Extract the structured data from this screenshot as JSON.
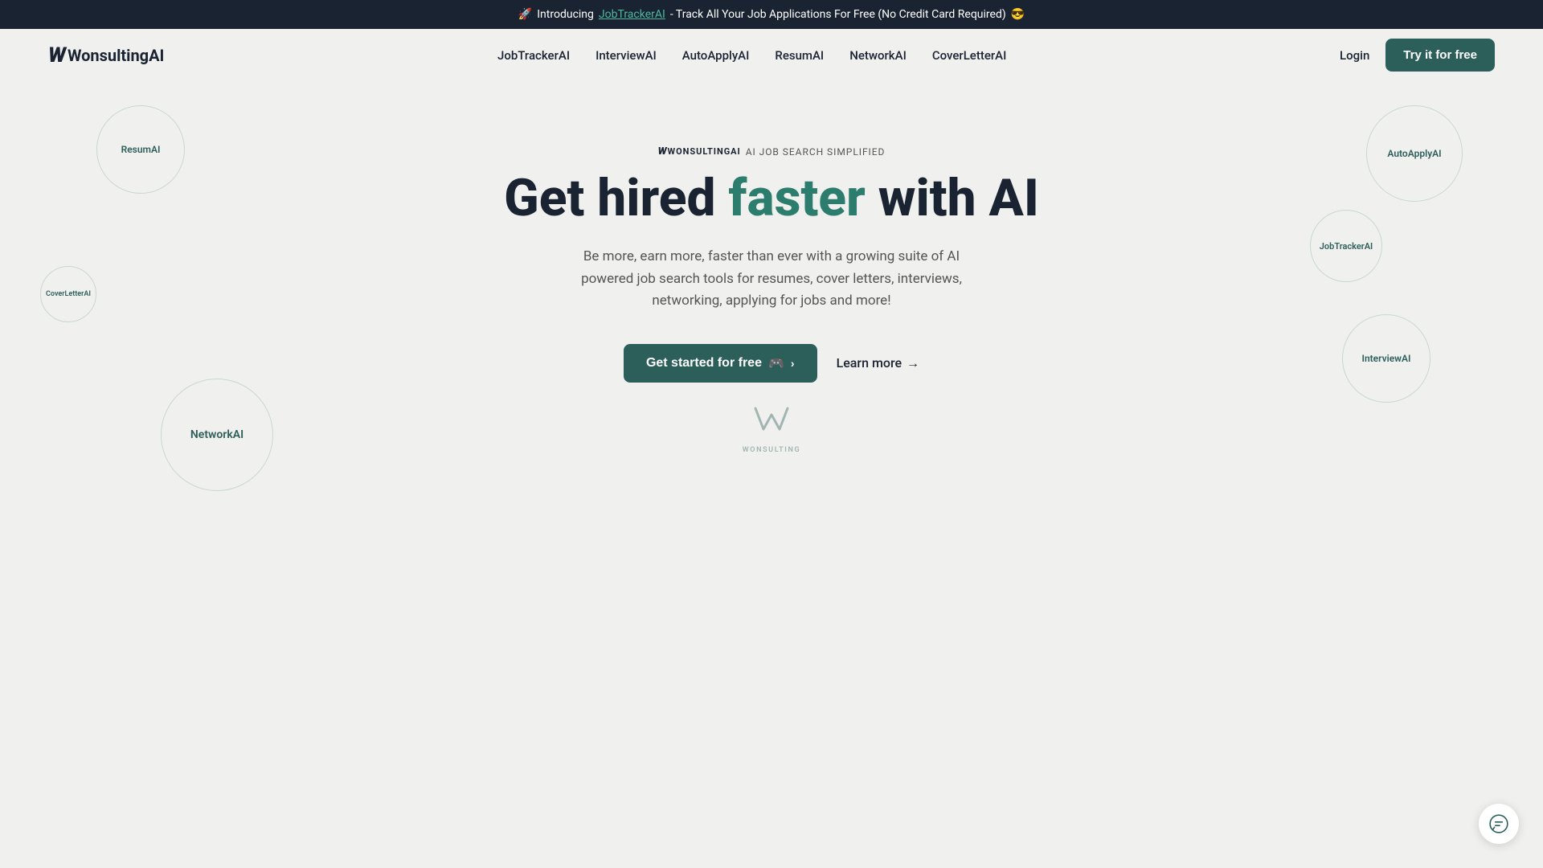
{
  "announcement": {
    "emoji_rocket": "🚀",
    "text_intro": "Introducing",
    "link_text": "JobTrackerAI",
    "text_after": "- Track All Your Job Applications For Free (No Credit Card Required)",
    "emoji_cool": "😎"
  },
  "nav": {
    "logo_text": "WonsultingAI",
    "logo_w": "W",
    "links": [
      {
        "label": "JobTrackerAI",
        "id": "nav-jobtracker"
      },
      {
        "label": "InterviewAI",
        "id": "nav-interviewai"
      },
      {
        "label": "AutoApplyAI",
        "id": "nav-autoapplyai"
      },
      {
        "label": "ResumAI",
        "id": "nav-resumai"
      },
      {
        "label": "NetworkAI",
        "id": "nav-networkai"
      },
      {
        "label": "CoverLetterAI",
        "id": "nav-coverletterai"
      }
    ],
    "login_label": "Login",
    "try_free_label": "Try it for free"
  },
  "hero": {
    "badge_logo": "WonsultingAI",
    "badge_text": "AI JOB SEARCH SIMPLIFIED",
    "title_part1": "Get hired ",
    "title_highlight": "faster",
    "title_part2": " with AI",
    "subtitle": "Be more, earn more, faster than ever with a growing suite of AI powered job search tools for resumes, cover letters, interviews, networking, applying for jobs and more!",
    "cta_label": "Get started for free",
    "cta_emoji": "🎮",
    "learn_more_label": "Learn more"
  },
  "floating_circles": [
    {
      "id": "circle-resume",
      "label": "ResumAI",
      "class": "circle-resume"
    },
    {
      "id": "circle-autoapply",
      "label": "AutoApplyAI",
      "class": "circle-autoapply"
    },
    {
      "id": "circle-coverletter",
      "label": "CoverLetterAI",
      "class": "circle-coverletter"
    },
    {
      "id": "circle-jobtracker",
      "label": "JobTrackerAI",
      "class": "circle-jobtracker"
    },
    {
      "id": "circle-networkai",
      "label": "NetworkAI",
      "class": "circle-networkai"
    },
    {
      "id": "circle-interviewai",
      "label": "InterviewAI",
      "class": "circle-interviewai"
    }
  ],
  "watermark": {
    "symbol": "⟨W⟩",
    "text": "WONSULTING"
  },
  "colors": {
    "dark_teal": "#2d5f5a",
    "navy": "#1a2332",
    "bg": "#f0f0ee",
    "accent_teal": "#4db8a0"
  }
}
